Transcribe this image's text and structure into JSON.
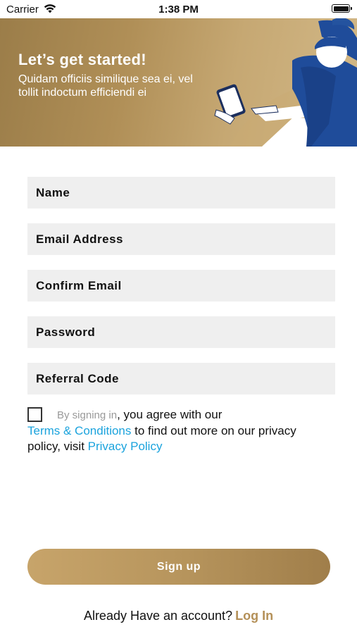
{
  "status_bar": {
    "carrier": "Carrier",
    "time": "1:38 PM"
  },
  "banner": {
    "title": "Let’s get started!",
    "subtitle": "Quidam officiis similique sea ei, vel tollit indoctum efficiendi ei"
  },
  "form": {
    "fields": [
      {
        "placeholder": "Name",
        "value": ""
      },
      {
        "placeholder": "Email Address",
        "value": ""
      },
      {
        "placeholder": "Confirm Email",
        "value": ""
      },
      {
        "placeholder": "Password",
        "value": ""
      },
      {
        "placeholder": "Referral Code",
        "value": ""
      }
    ],
    "agreement": {
      "checked": false,
      "muted_text": "By signing in",
      "text_1": ", you agree with our",
      "terms_link": "Terms & Conditions",
      "text_2": " to find out more on our privacy policy, visit ",
      "privacy_link": "Privacy Policy"
    },
    "signup_label": "Sign up"
  },
  "footer": {
    "question": "Already Have an account?",
    "login_link": "Log In"
  },
  "colors": {
    "accent_gold": "#b49058",
    "link_blue": "#1aa3dd",
    "field_bg": "#efefef"
  },
  "icons": [
    "wifi-icon",
    "battery-icon",
    "checkbox-icon"
  ]
}
